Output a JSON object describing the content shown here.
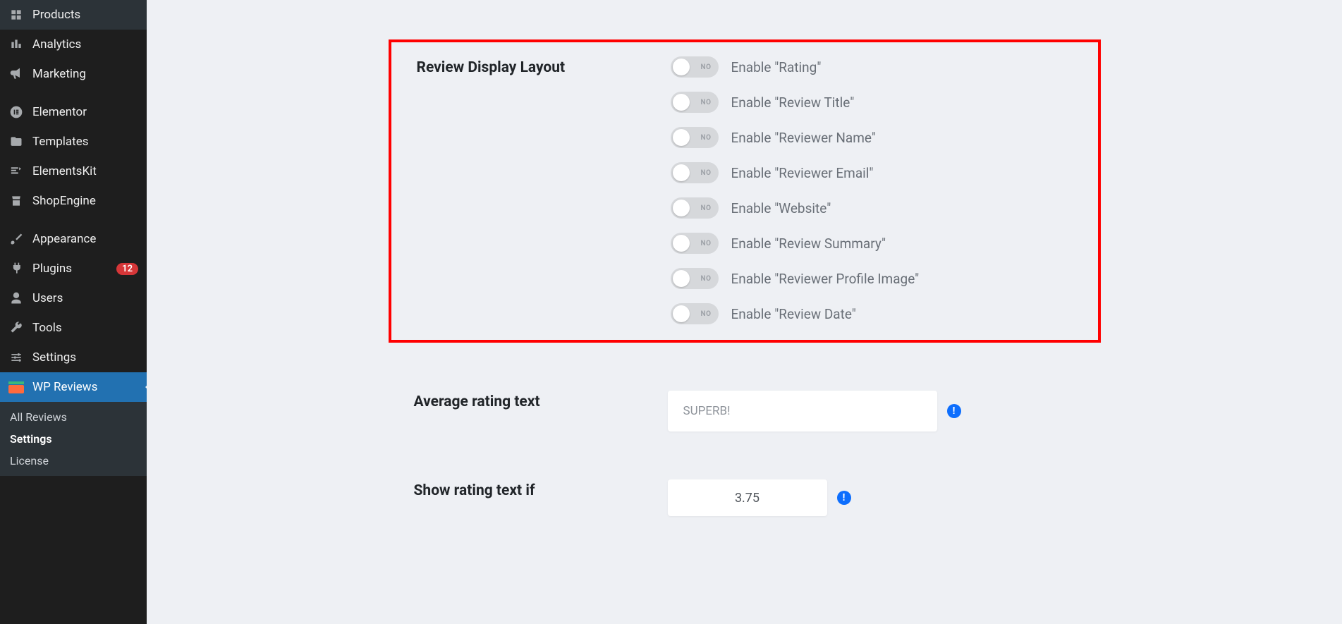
{
  "sidebar": {
    "items": [
      {
        "label": "Products"
      },
      {
        "label": "Analytics"
      },
      {
        "label": "Marketing"
      },
      {
        "label": "Elementor"
      },
      {
        "label": "Templates"
      },
      {
        "label": "ElementsKit"
      },
      {
        "label": "ShopEngine"
      },
      {
        "label": "Appearance"
      },
      {
        "label": "Plugins",
        "badge": "12"
      },
      {
        "label": "Users"
      },
      {
        "label": "Tools"
      },
      {
        "label": "Settings"
      },
      {
        "label": "WP Reviews"
      }
    ],
    "submenu": [
      {
        "label": "All Reviews"
      },
      {
        "label": "Settings"
      },
      {
        "label": "License"
      }
    ]
  },
  "settings": {
    "section_title": "Review Display Layout",
    "toggle_state": "NO",
    "toggles": [
      {
        "label": "Enable \"Rating\""
      },
      {
        "label": "Enable \"Review Title\""
      },
      {
        "label": "Enable \"Reviewer Name\""
      },
      {
        "label": "Enable \"Reviewer Email\""
      },
      {
        "label": "Enable \"Website\""
      },
      {
        "label": "Enable \"Review Summary\""
      },
      {
        "label": "Enable \"Reviewer Profile Image\""
      },
      {
        "label": "Enable \"Review Date\""
      }
    ],
    "avg_rating_label": "Average rating text",
    "avg_rating_value": "SUPERB!",
    "show_rating_label": "Show rating text if",
    "show_rating_value": "3.75",
    "info_symbol": "!"
  }
}
